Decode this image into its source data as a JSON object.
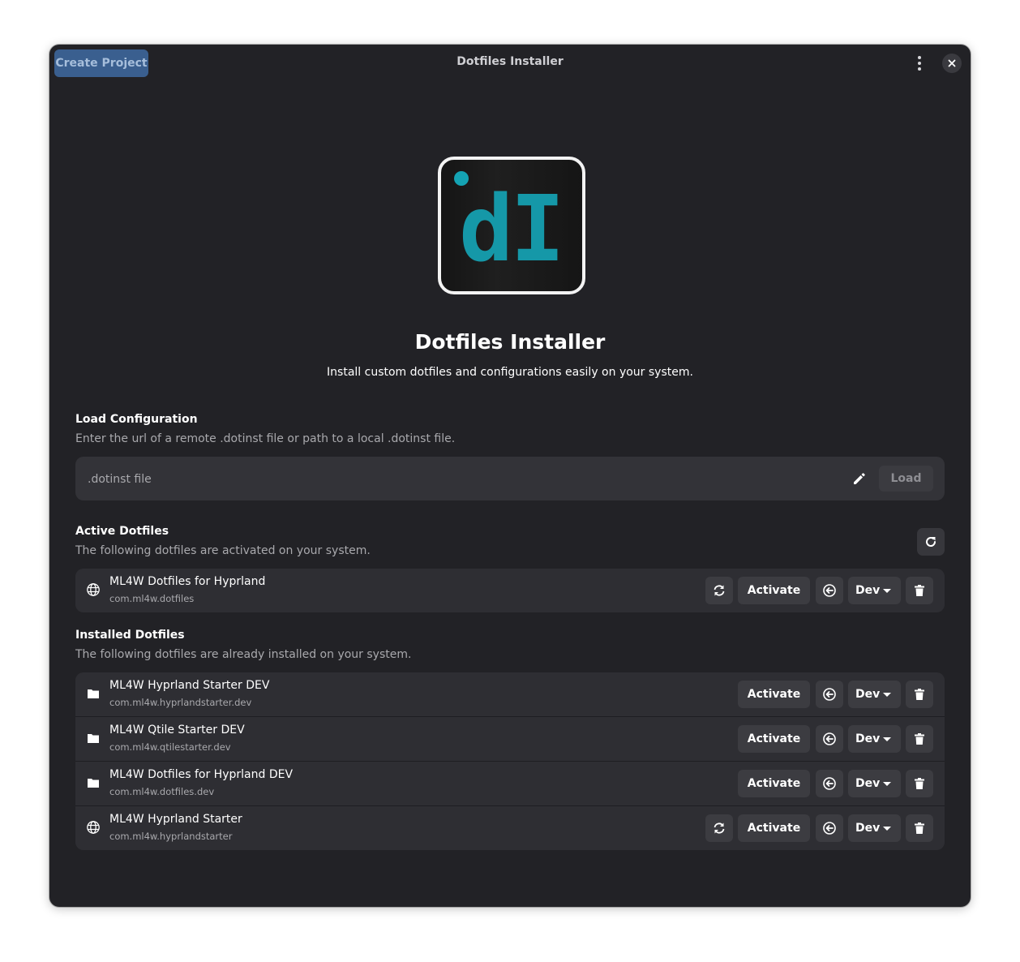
{
  "header": {
    "create_project_label": "Create Project",
    "window_title": "Dotfiles Installer",
    "menu_icon": "vertical-dots-icon",
    "close_icon": "close-icon"
  },
  "logo": {
    "text": "dI",
    "accent_color": "#1598a8"
  },
  "hero": {
    "title": "Dotfiles Installer",
    "subtitle": "Install custom dotfiles and configurations easily on your system."
  },
  "load_config": {
    "title": "Load Configuration",
    "description": "Enter the url of a remote .dotinst file or path to a local .dotinst file.",
    "placeholder": ".dotinst file",
    "load_label": "Load"
  },
  "active": {
    "title": "Active Dotfiles",
    "description": "The following dotfiles are activated on your system.",
    "items": [
      {
        "name": "ML4W Dotfiles for Hyprland",
        "id": "com.ml4w.dotfiles",
        "icon": "globe-icon",
        "activate_label": "Activate",
        "channel_label": "Dev"
      }
    ]
  },
  "installed": {
    "title": "Installed Dotfiles",
    "description": "The following dotfiles are already installed on your system.",
    "items": [
      {
        "name": "ML4W Hyprland Starter DEV",
        "id": "com.ml4w.hyprlandstarter.dev",
        "icon": "folder-icon",
        "activate_label": "Activate",
        "channel_label": "Dev"
      },
      {
        "name": "ML4W Qtile Starter DEV",
        "id": "com.ml4w.qtilestarter.dev",
        "icon": "folder-icon",
        "activate_label": "Activate",
        "channel_label": "Dev"
      },
      {
        "name": "ML4W Dotfiles for Hyprland DEV",
        "id": "com.ml4w.dotfiles.dev",
        "icon": "folder-icon",
        "activate_label": "Activate",
        "channel_label": "Dev"
      },
      {
        "name": "ML4W Hyprland Starter",
        "id": "com.ml4w.hyprlandstarter",
        "icon": "globe-icon",
        "activate_label": "Activate",
        "channel_label": "Dev"
      }
    ]
  }
}
